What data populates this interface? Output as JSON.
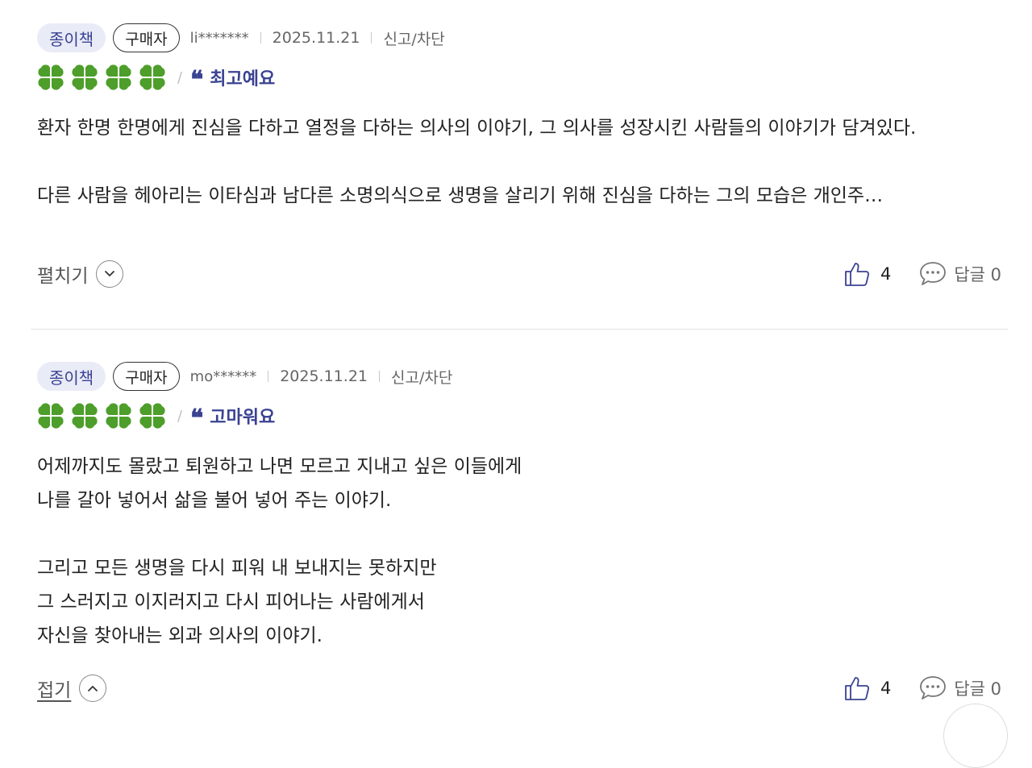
{
  "reviews": [
    {
      "format_tag": "종이책",
      "buyer_tag": "구매자",
      "user": "li*******",
      "date": "2025.11.21",
      "report_label": "신고/차단",
      "rating": 4,
      "summary": "최고예요",
      "body": "환자 한명 한명에게 진심을 다하고 열정을 다하는 의사의 이야기, 그 의사를 성장시킨 사람들의 이야기가 담겨있다.\n\n다른 사람을 헤아리는 이타심과 남다른 소명의식으로 생명을 살리기 위해 진심을 다하는 그의 모습은 개인주…",
      "toggle_label": "펼치기",
      "toggle_icon": "chevron-down-icon",
      "likes": "4",
      "comment_label": "답글 0"
    },
    {
      "format_tag": "종이책",
      "buyer_tag": "구매자",
      "user": "mo******",
      "date": "2025.11.21",
      "report_label": "신고/차단",
      "rating": 4,
      "summary": "고마워요",
      "body": "어제까지도 몰랐고 퇴원하고 나면 모르고 지내고 싶은 이들에게\n나를 갈아 넣어서 삶을 불어 넣어 주는 이야기.\n\n그리고 모든 생명을 다시 피워 내 보내지는 못하지만\n그 스러지고 이지러지고 다시 피어나는 사람에게서\n자신을 찾아내는 외과 의사의 이야기.",
      "toggle_label": "접기",
      "toggle_icon": "chevron-up-icon",
      "likes": "4",
      "comment_label": "답글 0"
    }
  ],
  "colors": {
    "accent": "#3a4292",
    "clover": "#4d9e2a",
    "tag_bg": "#e9ebf7",
    "divider": "#e3e3e3"
  }
}
